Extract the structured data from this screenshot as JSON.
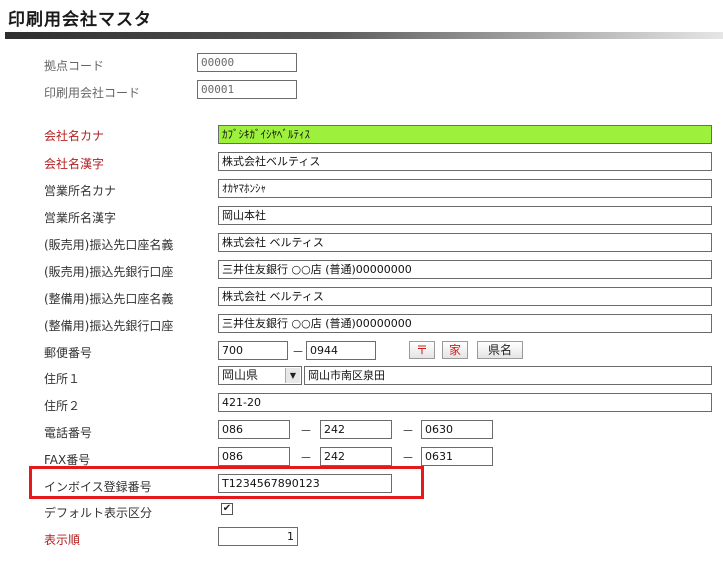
{
  "page_title": "印刷用会社マスタ",
  "fields": {
    "base_code": {
      "label": "拠点コード",
      "value": "00000"
    },
    "company_code": {
      "label": "印刷用会社コード",
      "value": "00001"
    },
    "company_kana": {
      "label": "会社名カナ",
      "value": "ｶﾌﾞｼｷｶﾞｲｼﾔﾍﾞﾙﾃｨｽ"
    },
    "company_kanji": {
      "label": "会社名漢字",
      "value": "株式会社ベルティス"
    },
    "office_kana": {
      "label": "営業所名カナ",
      "value": "ｵｶﾔﾏﾎﾝｼｬ"
    },
    "office_kanji": {
      "label": "営業所名漢字",
      "value": "岡山本社"
    },
    "sales_account_name": {
      "label": "(販売用)振込先口座名義",
      "value": "株式会社 ベルティス"
    },
    "sales_bank": {
      "label": "(販売用)振込先銀行口座",
      "value": "三井住友銀行 ○○店 (普通)00000000"
    },
    "maint_account_name": {
      "label": "(整備用)振込先口座名義",
      "value": "株式会社 ベルティス"
    },
    "maint_bank": {
      "label": "(整備用)振込先銀行口座",
      "value": "三井住友銀行 ○○店 (普通)00000000"
    },
    "postal": {
      "label": "郵便番号",
      "part1": "700",
      "separator": "－",
      "part2": "0944"
    },
    "address1": {
      "label": "住所１",
      "prefecture": "岡山県",
      "value": "岡山市南区泉田"
    },
    "address2": {
      "label": "住所２",
      "value": "421-20"
    },
    "phone": {
      "label": "電話番号",
      "part1": "086",
      "part2": "242",
      "part3": "0630",
      "separator": "－"
    },
    "fax": {
      "label": "FAX番号",
      "part1": "086",
      "part2": "242",
      "part3": "0631",
      "separator": "－"
    },
    "invoice": {
      "label": "インボイス登録番号",
      "value": "T1234567890123"
    },
    "default_flag": {
      "label": "デフォルト表示区分",
      "checked": "✔"
    },
    "display_order": {
      "label": "表示順",
      "value": "1"
    }
  },
  "postal_buttons": {
    "postal_mark": "〒",
    "house": "家",
    "prefecture": "県名"
  },
  "colors": {
    "required_label": "#b32020",
    "kana_highlight": "#9df03c",
    "annotation_box": "#e51919"
  }
}
